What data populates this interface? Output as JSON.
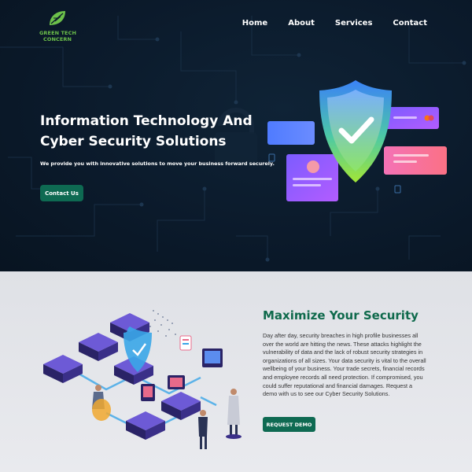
{
  "logo": {
    "line1": "GREEN TECH",
    "line2": "CONCERN"
  },
  "nav": {
    "items": [
      "Home",
      "About",
      "Services",
      "Contact"
    ]
  },
  "hero": {
    "title": "Information Technology And Cyber Security Solutions",
    "subtitle": "We provide you with innovative solutions to move your business forward securely.",
    "cta": "Contact Us",
    "illustration": "shield-checkmark-cards"
  },
  "security": {
    "title": "Maximize Your Security",
    "body": "Day after day, security breaches in high profile businesses all over the world are hitting the news. These attacks highlight the vulnerability of data and the lack of robust security strategies in organizations of all sizes. Your data security is vital to the overall wellbeing of your business. Your trade secrets, financial records and employee records all need protection. If compromised, you could suffer reputational and financial damages. Request a demo with us to see our Cyber Security Solutions.",
    "cta": "REQUEST DEMO",
    "illustration": "isometric-data-center"
  },
  "colors": {
    "hero_bg": "#0b1a2b",
    "brand_green": "#0e6a52",
    "logo_green": "#6cc04a",
    "heading_green": "#0f6a4c",
    "section_bg": "#e4e6ea"
  }
}
